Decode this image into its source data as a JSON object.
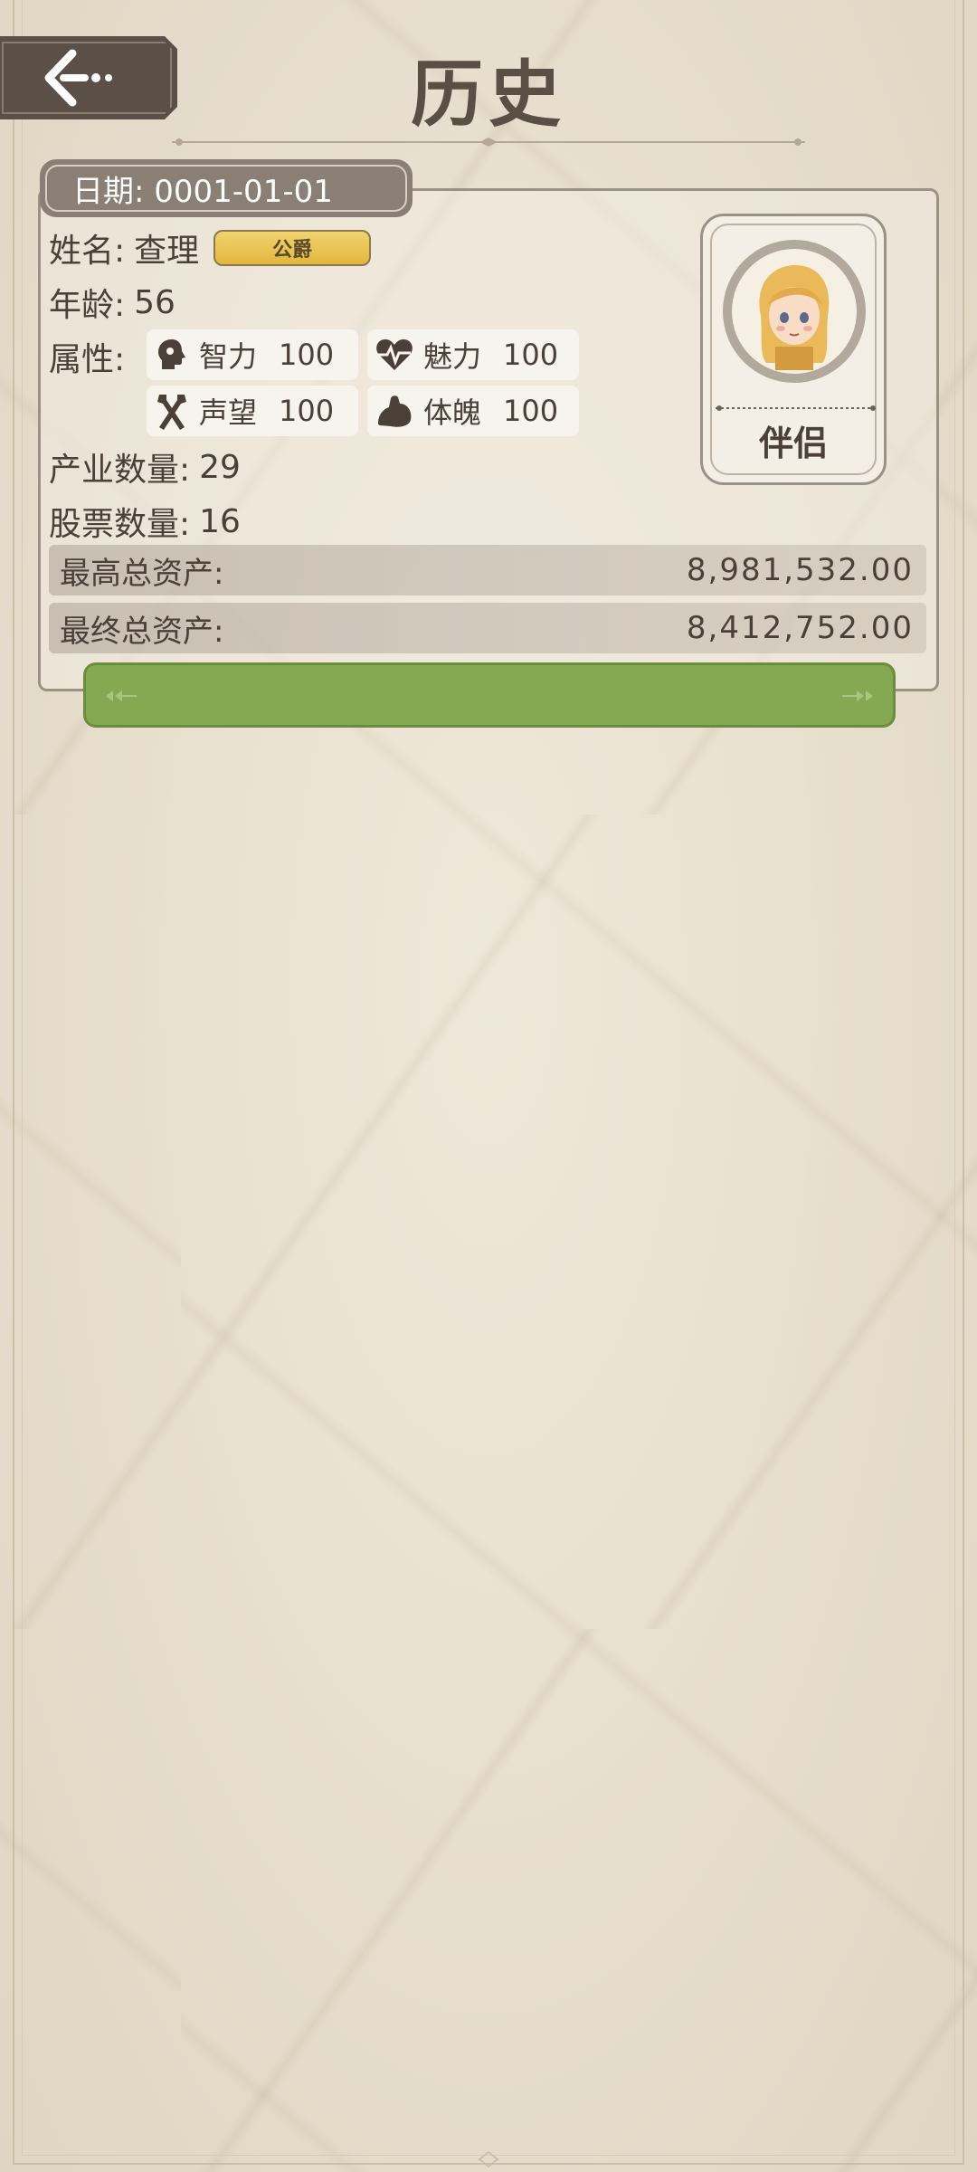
{
  "header": {
    "title": "历史"
  },
  "record": {
    "date_label": "日期: 0001-01-01",
    "name_label": "姓名:",
    "name_value": "查理",
    "title_badge": "公爵",
    "age_label": "年龄:",
    "age_value": "56",
    "attributes_label": "属性:",
    "attributes": [
      {
        "icon": "brain-icon",
        "name": "智力",
        "value": "100"
      },
      {
        "icon": "heartbeat-icon",
        "name": "魅力",
        "value": "100"
      },
      {
        "icon": "crossed-hammers-icon",
        "name": "声望",
        "value": "100"
      },
      {
        "icon": "flexed-arm-icon",
        "name": "体魄",
        "value": "100"
      }
    ],
    "industry_label": "产业数量:",
    "industry_value": "29",
    "stocks_label": "股票数量:",
    "stocks_value": "16",
    "highest_assets_label": "最高总资产:",
    "highest_assets_value": "8,981,532.00",
    "final_assets_label": "最终总资产:",
    "final_assets_value": "8,412,752.00",
    "partner_label": "伴侣"
  },
  "colors": {
    "background": "#e8e0d0",
    "text": "#4a4038",
    "badge_gold": "#e8c04f",
    "band_green": "#85a852"
  }
}
